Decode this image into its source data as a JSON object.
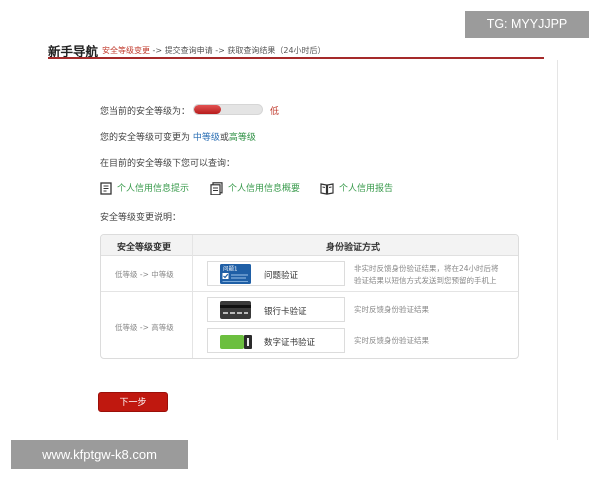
{
  "header": {
    "title": "新手导航",
    "breadcrumb": {
      "step1": "安全等级变更",
      "sep1": " -> ",
      "step2": "提交查询申请",
      "sep2": " -> ",
      "step3": "获取查询结果（24小时后）"
    }
  },
  "watermarks": {
    "top": "TG: MYYJJPP",
    "bottom": "www.kfptgw-k8.com"
  },
  "current": {
    "label": "您当前的安全等级为：",
    "level": "低",
    "level_fraction": 0.4
  },
  "change_to": {
    "prefix": "您的安全等级可变更为 ",
    "mid": "中等级",
    "or": "或",
    "high": "高等级"
  },
  "query_intro": "在目前的安全等级下您可以查询：",
  "links": [
    {
      "label": "个人信用信息提示",
      "icon": "doc-icon"
    },
    {
      "label": "个人信用信息概要",
      "icon": "doc-stack-icon"
    },
    {
      "label": "个人信用报告",
      "icon": "book-icon"
    }
  ],
  "change_desc_title": "安全等级变更说明：",
  "table": {
    "col1": "安全等级变更",
    "col2": "身份验证方式",
    "row1": {
      "from_to": "低等级 -> 中等级",
      "method": "问题验证",
      "card_label": "问题1",
      "desc1": "非实时反馈身份验证结果，将在24小时后将",
      "desc2": "验证结果以短信方式发送到您预留的手机上"
    },
    "row2": {
      "from_to": "低等级 -> 高等级",
      "method_a": "银行卡验证",
      "desc_a": "实时反馈身份验证结果",
      "method_b": "数字证书验证",
      "desc_b": "实时反馈身份验证结果"
    }
  },
  "next_button": "下一步",
  "colors": {
    "brand_red": "#c0180f",
    "link_green": "#3a9b4d",
    "mid_blue": "#2b6fb4"
  }
}
